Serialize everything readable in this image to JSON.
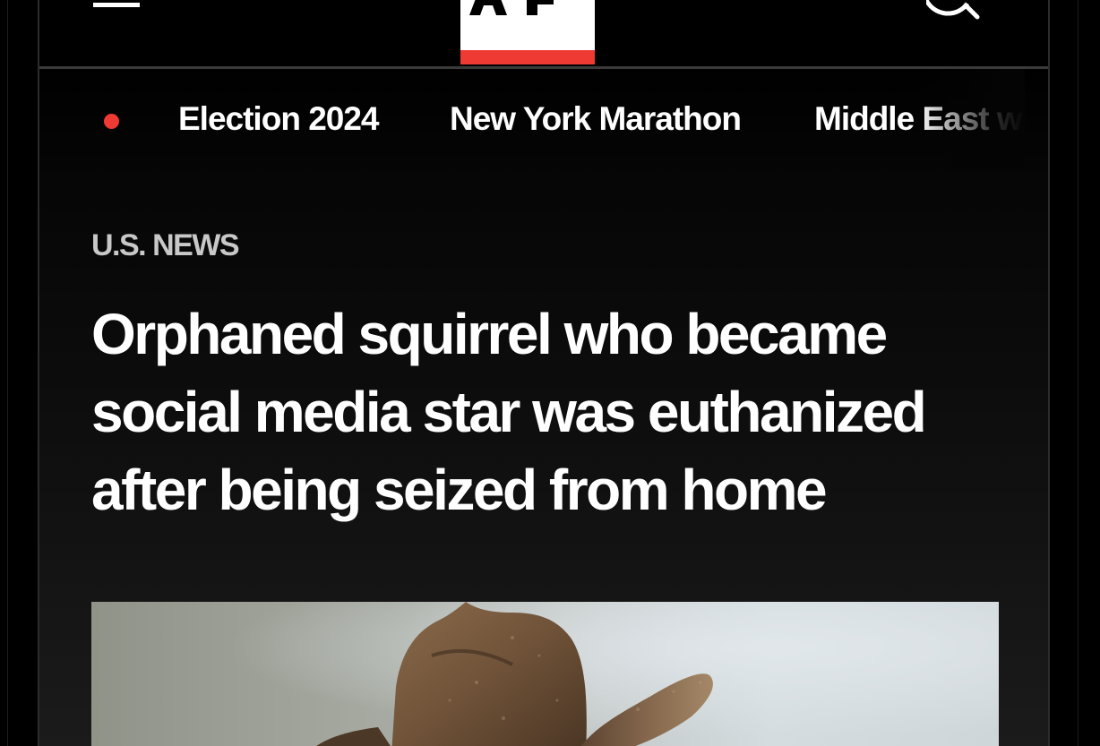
{
  "header": {
    "menu_icon": "hamburger-menu-icon",
    "logo_text": "AP",
    "logo_colors": {
      "background": "#ffffff",
      "accent_bar": "#ee3a33",
      "text": "#000000"
    },
    "search_icon": "search-icon"
  },
  "nav": {
    "live_indicator_color": "#ee3a33",
    "items": [
      {
        "label": "Election 2024"
      },
      {
        "label": "New York Marathon"
      },
      {
        "label": "Middle East w"
      }
    ]
  },
  "article": {
    "section": "U.S. NEWS",
    "headline": "Orphaned squirrel who became social media star was euthanized after being seized from home",
    "hero_image": "photo-of-brown-felt-cowboy-hat"
  },
  "colors": {
    "page_background": "#000000",
    "text_primary": "#ffffff",
    "text_secondary": "#c8c8c8",
    "accent": "#ee3a33"
  }
}
